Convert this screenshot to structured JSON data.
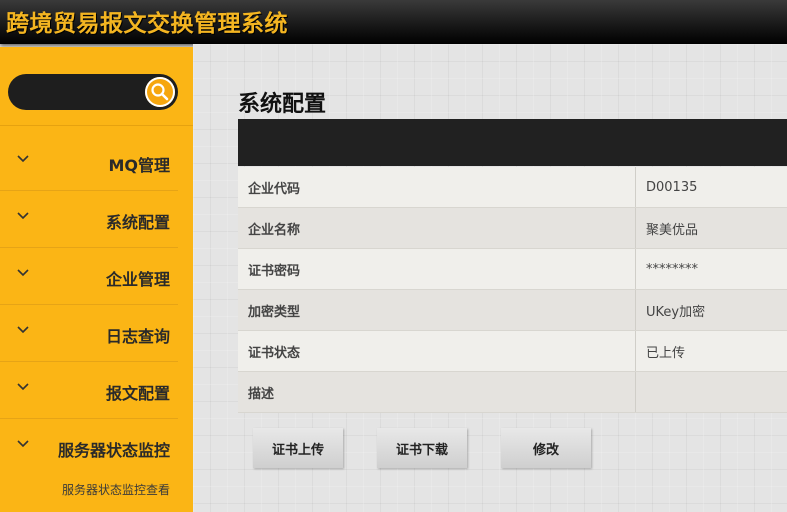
{
  "app": {
    "title": "跨境贸易报文交换管理系统"
  },
  "search": {
    "placeholder": "",
    "value": ""
  },
  "sidebar": {
    "items": [
      {
        "label": "MQ管理"
      },
      {
        "label": "系统配置"
      },
      {
        "label": "企业管理"
      },
      {
        "label": "日志查询"
      },
      {
        "label": "报文配置"
      },
      {
        "label": "服务器状态监控"
      }
    ],
    "sub_item": "服务器状态监控查看"
  },
  "main": {
    "title": "系统配置",
    "rows": [
      {
        "key": "企业代码",
        "value": "D00135"
      },
      {
        "key": "企业名称",
        "value": "聚美优品"
      },
      {
        "key": "证书密码",
        "value": "********"
      },
      {
        "key": "加密类型",
        "value": "UKey加密"
      },
      {
        "key": "证书状态",
        "value": "已上传"
      },
      {
        "key": "描述",
        "value": ""
      }
    ],
    "buttons": {
      "upload": "证书上传",
      "download": "证书下载",
      "edit": "修改"
    }
  },
  "colors": {
    "accent": "#fbb515",
    "header_bg": "#111111",
    "title_gold": "#f4b521",
    "table_head": "#212121"
  },
  "icons": {
    "search": "search-icon",
    "chevron": "chevron-down-icon"
  }
}
